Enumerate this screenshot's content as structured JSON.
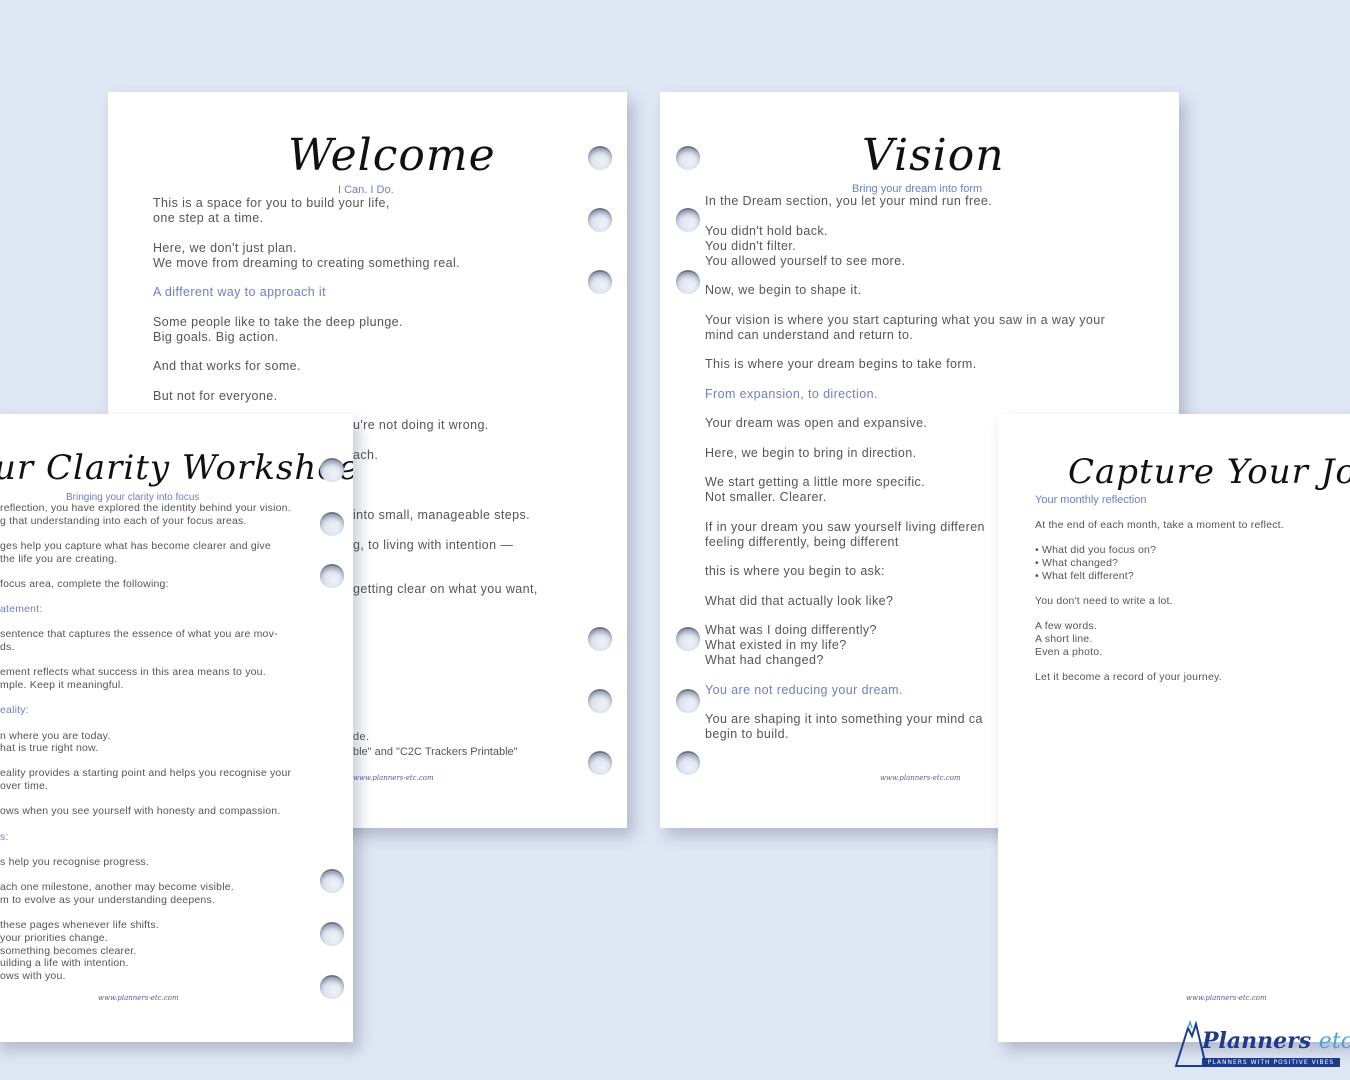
{
  "welcome": {
    "title": "Welcome",
    "subtitle": "I Can. I Do.",
    "paragraphs": [
      "This is a space for you to build your life,\none step at a time.",
      "Here, we don't just plan.\nWe move from dreaming to creating something real.",
      "A different way to approach it",
      "Some people like to take the deep plunge.\nBig goals. Big action.",
      "And that works for some.",
      "But not for everyone."
    ],
    "visible_right_fragments": [
      "u're not doing it wrong.",
      "ach.",
      "into small, manageable steps.",
      "g, to living with intention —",
      "getting clear on what you want,",
      "de.",
      "ble\" and \"C2C Trackers Printable\""
    ],
    "footer": "www.planners-etc.com"
  },
  "vision": {
    "title": "Vision",
    "subtitle": "Bring your dream into form",
    "paragraphs": [
      "In the Dream section, you let your mind run free.",
      "You didn't hold back.\nYou didn't filter.\nYou allowed yourself to see more.",
      "Now, we begin to shape it.",
      "Your vision is where you start capturing what you saw in a way your\nmind can understand and return to.",
      "This is where your dream begins to take form.",
      "From expansion, to direction.",
      "Your dream was open and expansive.",
      "Here, we begin to bring in direction.",
      "We start getting a little more specific.\nNot smaller. Clearer.",
      "If in your dream you saw yourself living differen\nfeeling differently, being different",
      "this is where you begin to ask:",
      "What did that actually look like?",
      "What was I doing differently?\nWhat existed in my life?\nWhat had changed?",
      "You are not reducing your dream.",
      "You are shaping it into something your mind ca\nbegin to build."
    ],
    "footer": "www.planners-etc.com"
  },
  "clarity": {
    "title": "ur Clarity Worksheet",
    "subtitle": "Bringing your clarity into focus",
    "paragraphs": [
      "reflection, you have explored the identity behind your vision.\ng that understanding into each of your focus areas.",
      "ges help you capture what has become clearer and give\nthe life you are creating.",
      "focus area, complete the following:",
      "atement:",
      " sentence that captures the essence of what you are mov-\nds.",
      "ement reflects what success in this area means to you.\nmple. Keep it meaningful.",
      "eality:",
      "n where you are today.\nhat is true right now.",
      "eality provides a starting point and helps you recognise your\n over time.",
      "ows when you see yourself with honesty and compassion.",
      "s:",
      "s help you recognise progress.",
      "ach one milestone, another may become visible.\nm to evolve as your understanding deepens.",
      " these pages whenever life shifts.\n your priorities change.\n something becomes clearer.\nuilding a life with intention.\nows with you."
    ],
    "footer": "www.planners-etc.com"
  },
  "capture": {
    "title": "Capture Your Journey",
    "subtitle": "Your monthly reflection",
    "paragraphs": [
      "At the end of each month, take a moment to reflect.",
      "• What did you focus on?\n• What changed?\n• What felt different?",
      "You don't need to write a lot.",
      "A few words.\nA short line.\nEven a photo.",
      "Let it become a record of your journey."
    ],
    "footer": "www.planners-etc.com"
  },
  "logo": {
    "name": "Planners",
    "suffix": "etc.",
    "tagline": "PLANNERS WITH POSITIVE VIBES"
  },
  "colors": {
    "background": "#dfe6f4",
    "accent": "#6f7fc6",
    "brand": "#1e3a8a"
  }
}
